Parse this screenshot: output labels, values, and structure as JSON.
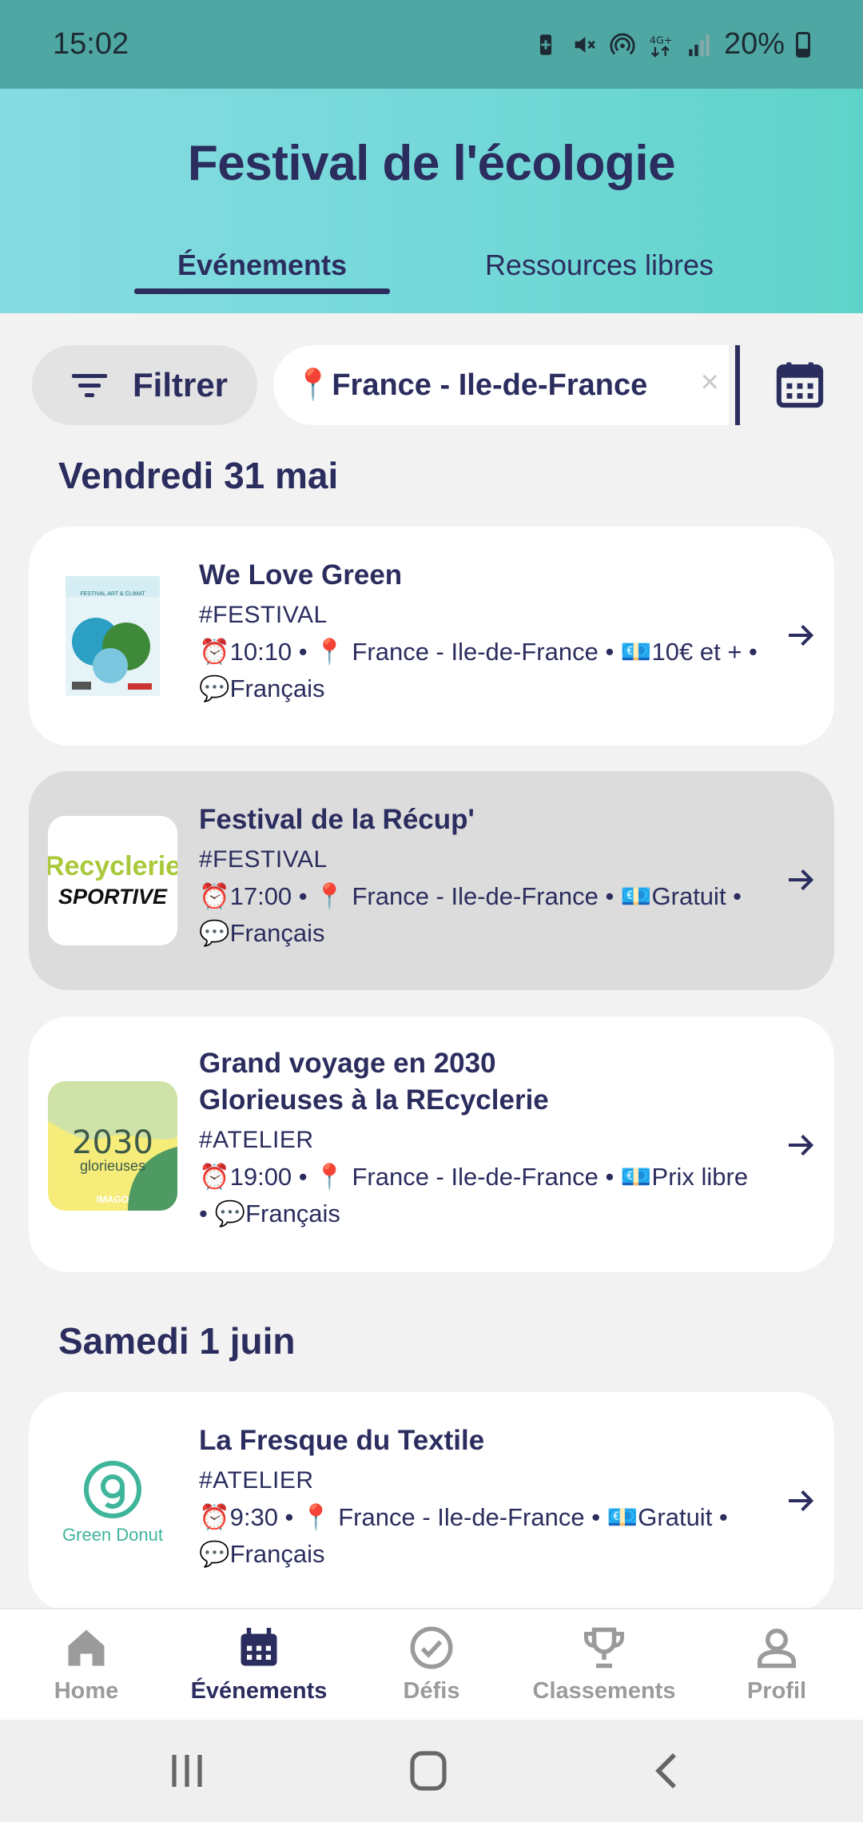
{
  "status": {
    "time": "15:02",
    "battery": "20%"
  },
  "header": {
    "title": "Festival de l'écologie",
    "tabs": [
      {
        "label": "Événements",
        "active": true
      },
      {
        "label": "Ressources libres",
        "active": false
      }
    ]
  },
  "filter": {
    "filter_label": "Filtrer",
    "location_label": "📍France - Ile-de-France",
    "clear_glyph": "×"
  },
  "days": [
    {
      "heading": "Vendredi 31 mai",
      "events": [
        {
          "title_lines": [
            "We Love Green"
          ],
          "tag": "#FESTIVAL",
          "meta_lines": [
            "⏰10:10 • 📍 France - Ile-de-France • 💶10€ et + •",
            "💬Français"
          ]
        },
        {
          "title_lines": [
            "Festival de la Récup'"
          ],
          "tag": "#FESTIVAL",
          "meta_lines": [
            "⏰17:00 • 📍 France - Ile-de-France • 💶Gratuit •",
            "💬Français"
          ]
        },
        {
          "title_lines": [
            "Grand voyage en 2030",
            "Glorieuses à la REcyclerie"
          ],
          "tag": "#ATELIER",
          "meta_lines": [
            "⏰19:00 • 📍 France - Ile-de-France • 💶Prix libre",
            "• 💬Français"
          ]
        }
      ]
    },
    {
      "heading": "Samedi 1 juin",
      "events": [
        {
          "title_lines": [
            "La Fresque du Textile"
          ],
          "tag": "#ATELIER",
          "meta_lines": [
            "⏰9:30 • 📍 France - Ile-de-France • 💶Gratuit •",
            "💬Français"
          ]
        }
      ]
    }
  ],
  "thumbs": {
    "poster_small_text": "FESTIVAL ART & CLIMAT",
    "recyclerie_top": "Recyclerie",
    "recyclerie_bottom": "SPORTIVE",
    "glorieuses_num": "2030",
    "glorieuses_word": "glorieuses",
    "glorieuses_brand": "IMAGO",
    "donut_brand": "Green Donut"
  },
  "bottom_nav": [
    {
      "label": "Home",
      "icon": "home-icon",
      "active": false
    },
    {
      "label": "Événements",
      "icon": "calendar-icon",
      "active": true
    },
    {
      "label": "Défis",
      "icon": "check-circle-icon",
      "active": false
    },
    {
      "label": "Classements",
      "icon": "trophy-icon",
      "active": false
    },
    {
      "label": "Profil",
      "icon": "user-icon",
      "active": false
    }
  ],
  "colors": {
    "primary": "#2b2d5e",
    "header_gradient_start": "#86dbe2",
    "header_gradient_end": "#5fd3c9",
    "status_bar": "#4fa7a3",
    "inactive": "#9b9b9b"
  }
}
